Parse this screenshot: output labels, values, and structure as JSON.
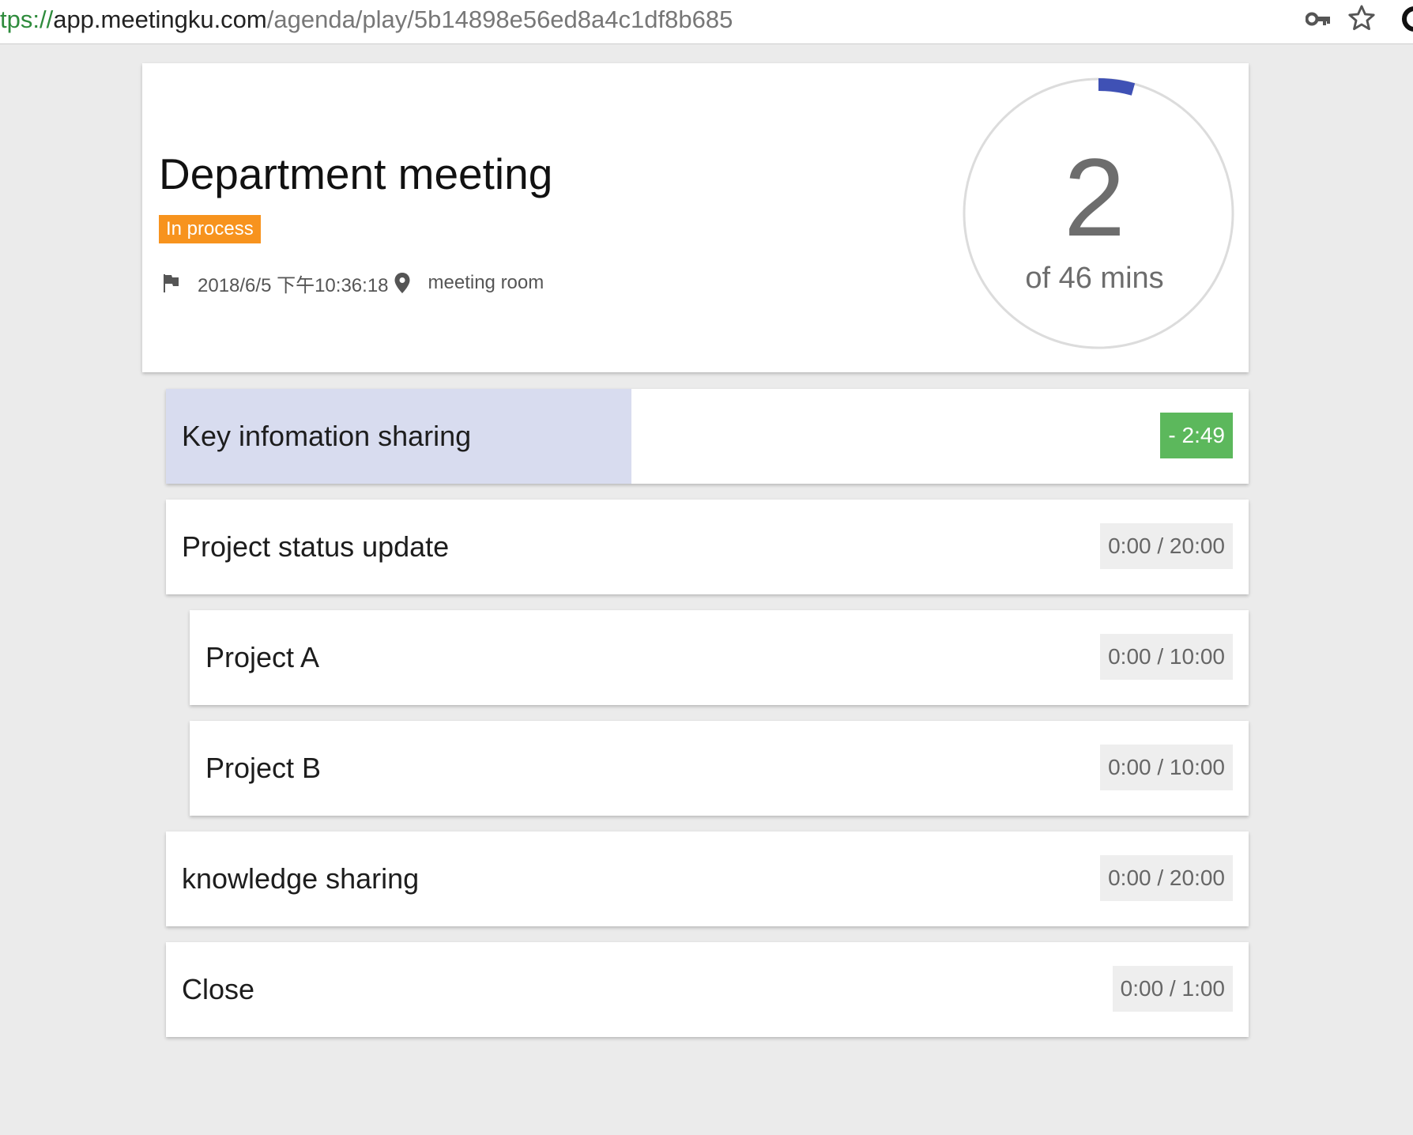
{
  "browser": {
    "url_scheme": "tps://",
    "url_host": "app.meetingku.com",
    "url_path": "/agenda/play/5b14898e56ed8a4c1df8b685"
  },
  "meeting": {
    "title": "Department meeting",
    "status": "In process",
    "datetime": "2018/6/5 下午10:36:18",
    "location": "meeting room"
  },
  "timer": {
    "elapsed": "2",
    "total_label": "of 46 mins",
    "elapsed_fraction": 0.0435,
    "ring_color": "#3f51b5"
  },
  "agenda": [
    {
      "title": "Key infomation sharing",
      "time": "- 2:49",
      "active": true,
      "progress_fraction": 0.43
    },
    {
      "title": "Project status update",
      "time": "0:00 / 20:00",
      "active": false
    },
    {
      "title": "Project A",
      "time": "0:00 / 10:00",
      "active": false
    },
    {
      "title": "Project B",
      "time": "0:00 / 10:00",
      "active": false
    },
    {
      "title": "knowledge sharing",
      "time": "0:00 / 20:00",
      "active": false
    },
    {
      "title": "Close",
      "time": "0:00 / 1:00",
      "active": false
    }
  ],
  "colors": {
    "status_badge": "#f7931e",
    "active_time_badge": "#5cb85c",
    "active_progress": "#d8dcef"
  },
  "icons": {
    "key": "key-icon",
    "star": "star-icon",
    "flag": "flag-icon",
    "location": "location-pin-icon"
  }
}
